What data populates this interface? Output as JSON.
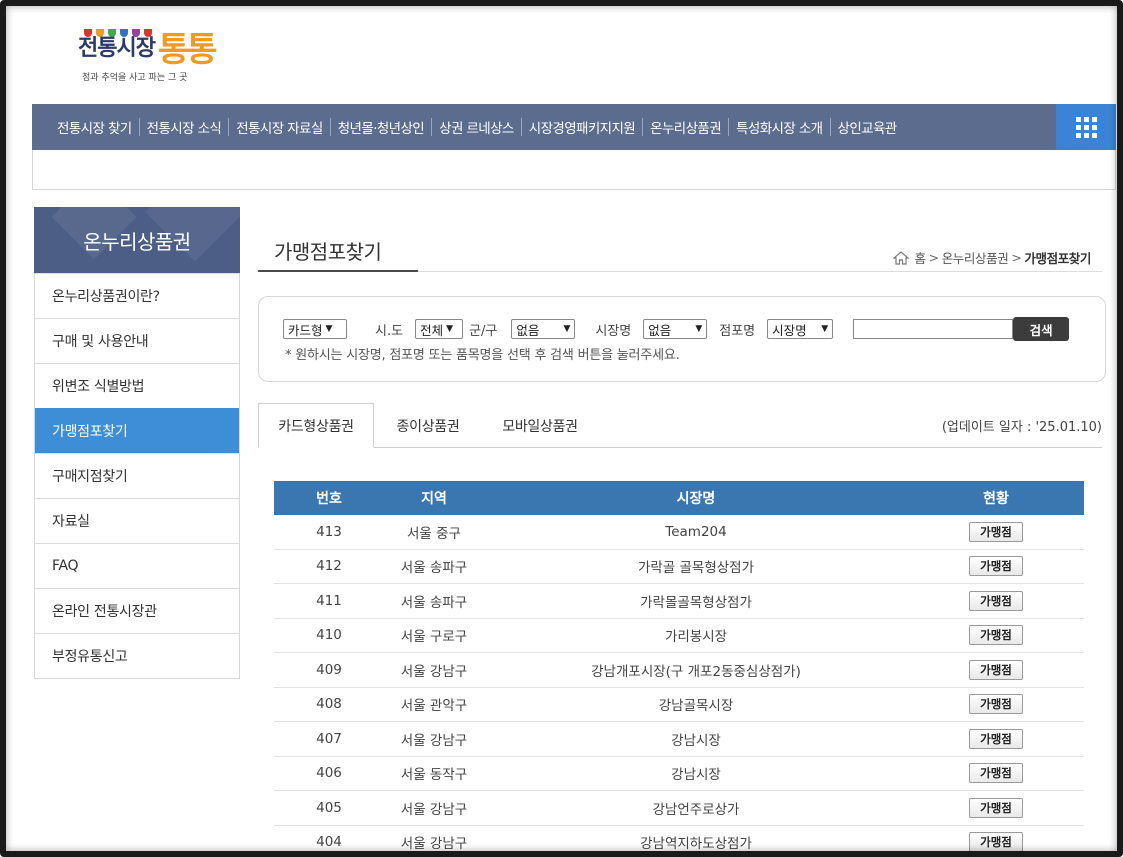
{
  "logo": {
    "main": "전통시장",
    "accent": "통통",
    "sub": "정과 추억을 사고 파는 그 곳",
    "flag_colors": [
      "#e0322d",
      "#f29a1f",
      "#3cae49",
      "#2f75c4",
      "#9b3fa2",
      "#e0322d"
    ]
  },
  "nav": {
    "items": [
      "전통시장 찾기",
      "전통시장 소식",
      "전통시장 자료실",
      "청년몰·청년상인",
      "상권 르네상스",
      "시장경영패키지지원",
      "온누리상품권",
      "특성화시장 소개",
      "상인교육관"
    ],
    "grid_icon": "grid-menu-icon"
  },
  "sidebar": {
    "title": "온누리상품권",
    "items": [
      "온누리상품권이란?",
      "구매 및 사용안내",
      "위변조 식별방법",
      "가맹점포찾기",
      "구매지점찾기",
      "자료실",
      "FAQ",
      "온라인 전통시장관",
      "부정유통신고"
    ],
    "active_index": 3
  },
  "page": {
    "title": "가맹점포찾기",
    "breadcrumb": [
      "홈",
      "온누리상품권",
      "가맹점포찾기"
    ],
    "sep": ">"
  },
  "search": {
    "type_value": "카드형",
    "sido_label": "시.도",
    "sido_value": "전체",
    "gungu_label": "군/구",
    "gungu_value": "없음",
    "market_label": "시장명",
    "market_value": "없음",
    "store_label": "점포명",
    "store_value": "시장명",
    "input_value": "",
    "button": "검색",
    "note": "* 원하시는 시장명, 점포명 또는 품목명을 선택 후 검색 버튼을 눌러주세요."
  },
  "tabs": {
    "items": [
      "카드형상품권",
      "종이상품권",
      "모바일상품권"
    ],
    "active_index": 0,
    "update": "(업데이트 일자 : '25.01.10)"
  },
  "table": {
    "headers": [
      "번호",
      "지역",
      "시장명",
      "현황"
    ],
    "status_label": "가맹점",
    "rows": [
      {
        "no": "413",
        "region": "서울 중구",
        "market": "Team204"
      },
      {
        "no": "412",
        "region": "서울 송파구",
        "market": "가락골 골목형상점가"
      },
      {
        "no": "411",
        "region": "서울 송파구",
        "market": "가락몰골목형상점가"
      },
      {
        "no": "410",
        "region": "서울 구로구",
        "market": "가리봉시장"
      },
      {
        "no": "409",
        "region": "서울 강남구",
        "market": "강남개포시장(구 개포2동중심상점가)"
      },
      {
        "no": "408",
        "region": "서울 관악구",
        "market": "강남골목시장"
      },
      {
        "no": "407",
        "region": "서울 강남구",
        "market": "강남시장"
      },
      {
        "no": "406",
        "region": "서울 동작구",
        "market": "강남시장"
      },
      {
        "no": "405",
        "region": "서울 강남구",
        "market": "강남언주로상가"
      },
      {
        "no": "404",
        "region": "서울 강남구",
        "market": "강남역지하도상점가"
      }
    ]
  },
  "colors": {
    "nav_bg": "#5b6c8f",
    "accent_blue": "#3d8ed6",
    "table_head": "#3a77b0",
    "logo_orange": "#f29a1f"
  }
}
